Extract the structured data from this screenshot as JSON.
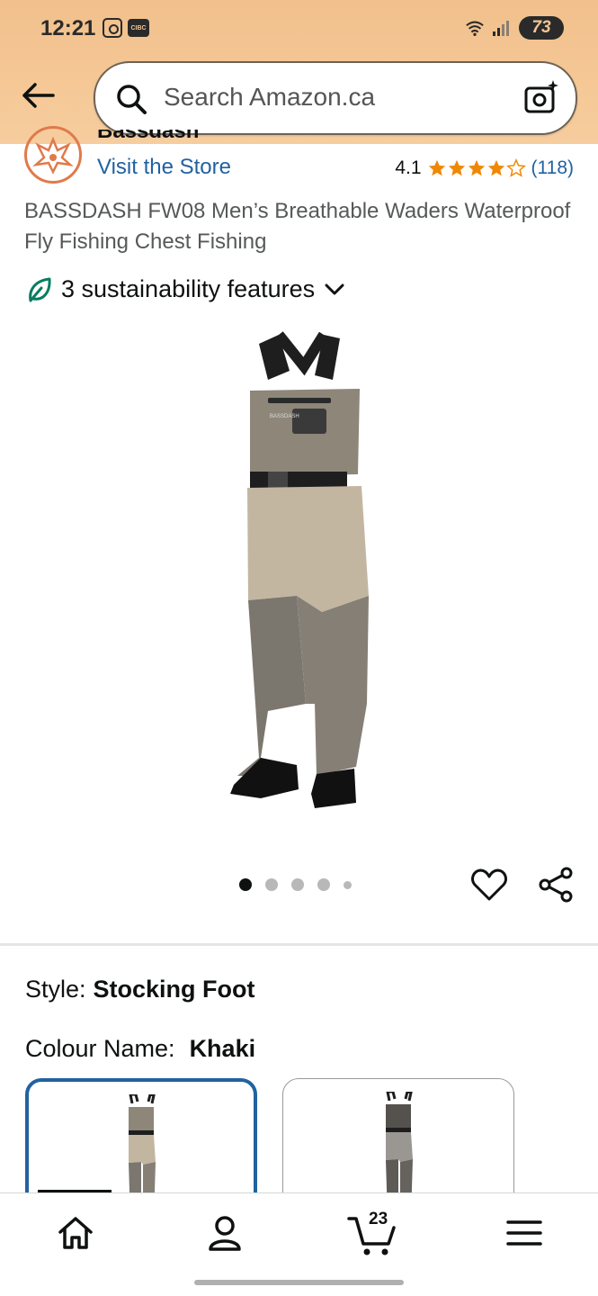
{
  "status_bar": {
    "time": "12:21",
    "carrier_badge": "CIBC",
    "battery": "73"
  },
  "search": {
    "placeholder": "Search Amazon.ca"
  },
  "brand": {
    "name": "Bassdash",
    "visit_store": "Visit the Store"
  },
  "rating": {
    "value": "4.1",
    "stars": 4.1,
    "count": "(118)"
  },
  "product": {
    "title": "BASSDASH FW08 Men’s Breathable Waders Waterproof Fly Fishing Chest Fishing",
    "image_count": 5,
    "active_image": 1
  },
  "sustainability": {
    "label": "3 sustainability features"
  },
  "variants": {
    "style_label": "Style:",
    "style_value": "Stocking Foot",
    "colour_label": "Colour Name:",
    "colour_value": "Khaki",
    "swatches": [
      "Khaki",
      "Grey"
    ]
  },
  "bottom_nav": {
    "cart_count": "23",
    "items": [
      "home-icon",
      "account-icon",
      "cart-icon",
      "menu-icon"
    ]
  },
  "colors": {
    "header": "#f3c594",
    "link": "#2162a1",
    "star": "#f08804",
    "leaf": "#067d62"
  }
}
